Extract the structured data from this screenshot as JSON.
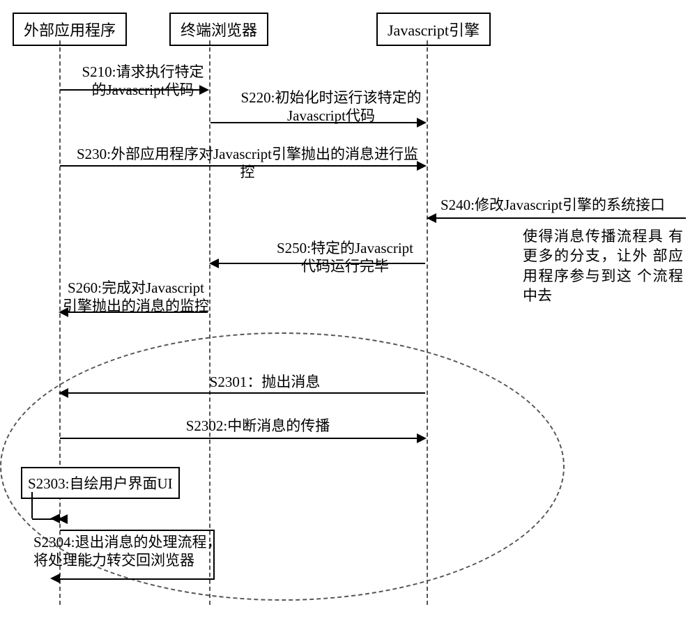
{
  "participants": {
    "ext_app": "外部应用程序",
    "browser": "终端浏览器",
    "js_engine": "Javascript引擎"
  },
  "messages": {
    "s210": "S210:请求执行特定\n的Javascript代码",
    "s220": "S220:初始化时运行该特定的\nJavascript代码",
    "s230": "S230:外部应用程序对Javascript引擎抛出的消息进行监控",
    "s240": "S240:修改Javascript引擎的系统接口",
    "s250": "S250:特定的Javascript\n代码运行完毕",
    "s260": "S260:完成对Javascript\n引擎抛出的消息的监控",
    "s2301": "S2301：抛出消息",
    "s2302": "S2302:中断消息的传播",
    "s2303": "S2303:自绘用户界面UI",
    "s2304": "S2304:退出消息的处理流程，\n将处理能力转交回浏览器"
  },
  "note_s240": "使得消息传播流程具\n有更多的分支，让外\n部应用程序参与到这\n个流程中去",
  "chart_data": {
    "type": "sequence_diagram",
    "participants": [
      "外部应用程序",
      "终端浏览器",
      "Javascript引擎"
    ],
    "steps": [
      {
        "id": "S210",
        "from": "外部应用程序",
        "to": "终端浏览器",
        "label": "请求执行特定的Javascript代码"
      },
      {
        "id": "S220",
        "from": "终端浏览器",
        "to": "Javascript引擎",
        "label": "初始化时运行该特定的Javascript代码"
      },
      {
        "id": "S230",
        "from": "外部应用程序",
        "to": "Javascript引擎",
        "label": "外部应用程序对Javascript引擎抛出的消息进行监控"
      },
      {
        "id": "S240",
        "from": "(external)",
        "to": "Javascript引擎",
        "label": "修改Javascript引擎的系统接口",
        "note": "使得消息传播流程具有更多的分支，让外部应用程序参与到这个流程中去"
      },
      {
        "id": "S250",
        "from": "Javascript引擎",
        "to": "终端浏览器",
        "label": "特定的Javascript代码运行完毕"
      },
      {
        "id": "S260",
        "from": "终端浏览器",
        "to": "外部应用程序",
        "label": "完成对Javascript引擎抛出的消息的监控"
      },
      {
        "id": "S2301",
        "from": "Javascript引擎",
        "to": "外部应用程序",
        "label": "抛出消息",
        "group": "detail"
      },
      {
        "id": "S2302",
        "from": "外部应用程序",
        "to": "Javascript引擎",
        "label": "中断消息的传播",
        "group": "detail"
      },
      {
        "id": "S2303",
        "from": "外部应用程序",
        "to": "外部应用程序",
        "label": "自绘用户界面UI",
        "group": "detail"
      },
      {
        "id": "S2304",
        "from": "外部应用程序",
        "to": "外部应用程序",
        "label": "退出消息的处理流程，将处理能力转交回浏览器",
        "group": "detail"
      }
    ]
  }
}
